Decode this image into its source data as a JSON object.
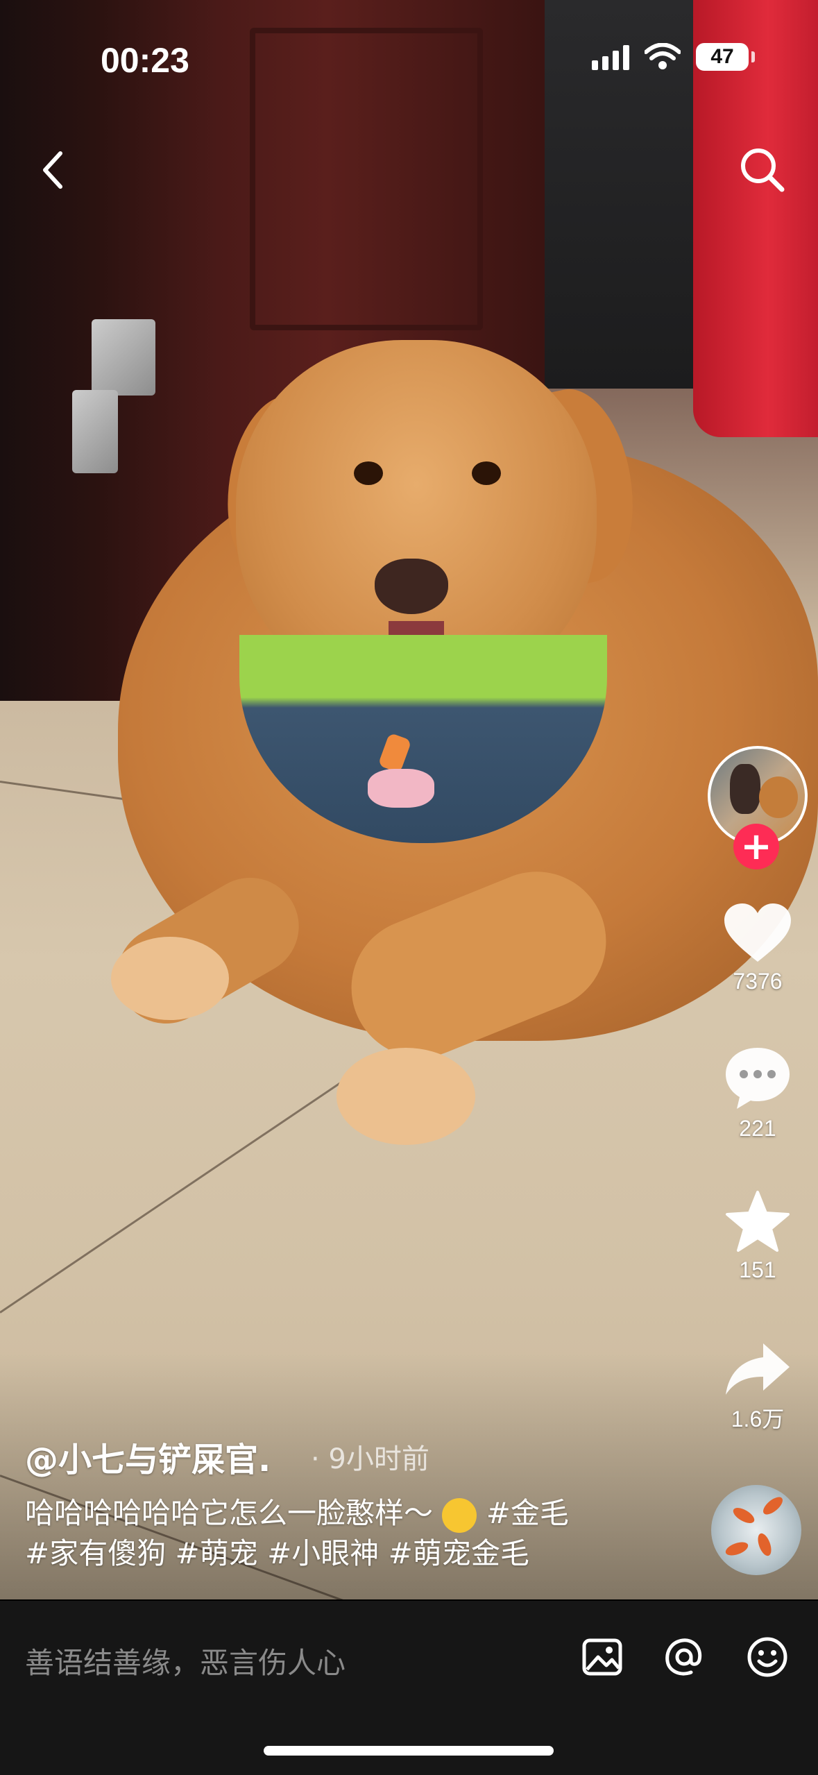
{
  "status_bar": {
    "time": "00:23",
    "battery": "47"
  },
  "video": {
    "description": "golden retriever photo"
  },
  "rail": {
    "likes": "7376",
    "comments": "221",
    "favorites": "151",
    "shares": "1.6万"
  },
  "post": {
    "author": "@小七与铲屎官.",
    "time_ago": "· 9小时前",
    "caption_text": "哈哈哈哈哈哈它怎么一脸憨样～",
    "tag1": "#金毛",
    "tags_line2": "#家有傻狗 #萌宠 #小眼神 #萌宠金毛"
  },
  "comment_bar": {
    "placeholder": "善语结善缘，恶言伤人心"
  },
  "colors": {
    "follow": "#fe2c55",
    "bar_bg": "#161616"
  }
}
